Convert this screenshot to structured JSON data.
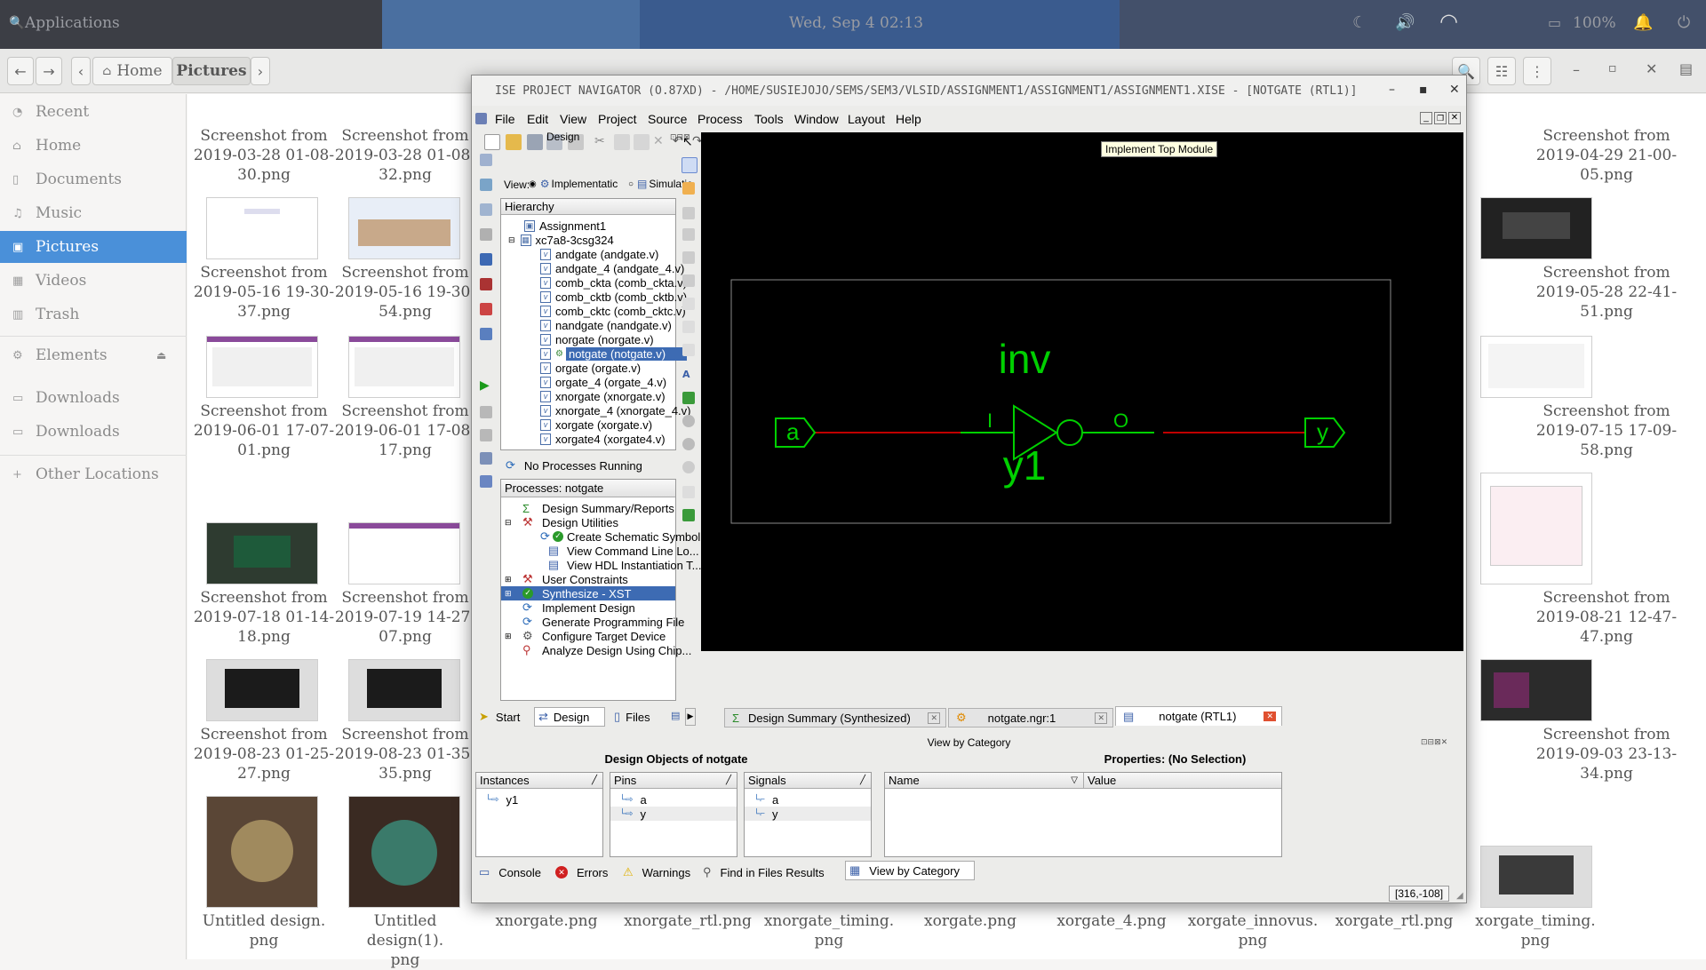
{
  "topbar": {
    "activities": "Applications",
    "clock": "Wed, Sep  4  02:13",
    "battery": "100%"
  },
  "files": {
    "breadcrumb": {
      "home": "Home",
      "current": "Pictures"
    },
    "sidebar": [
      {
        "label": "Recent",
        "icon": "clock-icon"
      },
      {
        "label": "Home",
        "icon": "home-icon"
      },
      {
        "label": "Documents",
        "icon": "document-icon"
      },
      {
        "label": "Music",
        "icon": "music-icon"
      },
      {
        "label": "Pictures",
        "icon": "picture-icon",
        "selected": true
      },
      {
        "label": "Videos",
        "icon": "video-icon"
      },
      {
        "label": "Trash",
        "icon": "trash-icon"
      },
      {
        "label": "Elements",
        "icon": "drive-icon"
      },
      {
        "label": "Downloads",
        "icon": "drive-icon"
      },
      {
        "label": "Downloads",
        "icon": "drive-icon"
      },
      {
        "label": "Other Locations",
        "icon": "plus-icon"
      }
    ],
    "items": [
      {
        "name": "Screenshot from 2019-03-28 01-08-30.png",
        "l1": "Screenshot from",
        "l2": "2019-03-28 01-08-",
        "l3": "30.png"
      },
      {
        "name": "Screenshot from 2019-03-28 01-08-32.png",
        "l1": "Screenshot from",
        "l2": "2019-03-28 01-08-",
        "l3": "32.png"
      },
      {
        "name": "Screenshot from 2019-04-29 21-00-05.png",
        "l1": "Screenshot from",
        "l2": "2019-04-29 21-00-",
        "l3": "05.png"
      },
      {
        "name": "Screenshot from 2019-05-16 19-30-37.png",
        "l1": "Screenshot from",
        "l2": "2019-05-16 19-30-",
        "l3": "37.png"
      },
      {
        "name": "Screenshot from 2019-05-16 19-30-54.png",
        "l1": "Screenshot from",
        "l2": "2019-05-16 19-30-",
        "l3": "54.png"
      },
      {
        "name": "Screenshot from 2019-05-28 22-41-51.png",
        "l1": "Screenshot from",
        "l2": "2019-05-28 22-41-",
        "l3": "51.png"
      },
      {
        "name": "Screenshot from 2019-06-01 17-07-01.png",
        "l1": "Screenshot from",
        "l2": "2019-06-01 17-07-",
        "l3": "01.png"
      },
      {
        "name": "Screenshot from 2019-06-01 17-08-17.png",
        "l1": "Screenshot from",
        "l2": "2019-06-01 17-08-",
        "l3": "17.png"
      },
      {
        "name": "Screenshot from 2019-07-15 17-09-58.png",
        "l1": "Screenshot from",
        "l2": "2019-07-15 17-09-",
        "l3": "58.png"
      },
      {
        "name": "Screenshot from 2019-07-18 01-14-18.png",
        "l1": "Screenshot from",
        "l2": "2019-07-18 01-14-",
        "l3": "18.png"
      },
      {
        "name": "Screenshot from 2019-07-19 14-27-07.png",
        "l1": "Screenshot from",
        "l2": "2019-07-19 14-27-",
        "l3": "07.png"
      },
      {
        "name": "Screenshot from 2019-08-21 12-47-47.png",
        "l1": "Screenshot from",
        "l2": "2019-08-21 12-47-",
        "l3": "47.png"
      },
      {
        "name": "Screenshot from 2019-08-23 01-25-27.png",
        "l1": "Screenshot from",
        "l2": "2019-08-23 01-25-",
        "l3": "27.png"
      },
      {
        "name": "Screenshot from 2019-08-23 01-35-35.png",
        "l1": "Screenshot from",
        "l2": "2019-08-23 01-35-",
        "l3": "35.png"
      },
      {
        "name": "Screenshot from 2019-09-03 23-13-34.png",
        "l1": "Screenshot from",
        "l2": "2019-09-03 23-13-",
        "l3": "34.png"
      },
      {
        "name": "Untitled design.png",
        "l1": "Untitled design.",
        "l2": "png",
        "l3": ""
      },
      {
        "name": "Untitled design(1).png",
        "l1": "Untitled design(1).",
        "l2": "png",
        "l3": ""
      },
      {
        "name": "xnorgate.png",
        "l1": "xnorgate.png",
        "l2": "",
        "l3": ""
      },
      {
        "name": "xnorgate_rtl.png",
        "l1": "xnorgate_rtl.png",
        "l2": "",
        "l3": ""
      },
      {
        "name": "xnorgate_timing.png",
        "l1": "xnorgate_timing.",
        "l2": "png",
        "l3": ""
      },
      {
        "name": "xorgate.png",
        "l1": "xorgate.png",
        "l2": "",
        "l3": ""
      },
      {
        "name": "xorgate_4.png",
        "l1": "xorgate_4.png",
        "l2": "",
        "l3": ""
      },
      {
        "name": "xorgate_innovus.png",
        "l1": "xorgate_innovus.",
        "l2": "png",
        "l3": ""
      },
      {
        "name": "xorgate_rtl.png",
        "l1": "xorgate_rtl.png",
        "l2": "",
        "l3": ""
      },
      {
        "name": "xorgate_timing.png",
        "l1": "xorgate_timing.",
        "l2": "png",
        "l3": ""
      }
    ]
  },
  "ise": {
    "title": "ISE PROJECT NAVIGATOR (O.87XD) - /HOME/SUSIEJOJO/SEMS/SEM3/VLSID/ASSIGNMENT1/ASSIGNMENT1/ASSIGNMENT1.XISE - [NOTGATE (RTL1)]",
    "menus": [
      "File",
      "Edit",
      "View",
      "Project",
      "Source",
      "Process",
      "Tools",
      "Window",
      "Layout",
      "Help"
    ],
    "tooltip": "Implement Top Module",
    "design_panel": {
      "title": "Design",
      "view_label": "View:",
      "view_impl": "Implementatic",
      "view_sim": "Simulatic",
      "hierarchy_header": "Hierarchy",
      "tree": [
        {
          "label": "Assignment1",
          "indent": 0,
          "icon": "project-icon"
        },
        {
          "label": "xc7a8-3csg324",
          "indent": 0,
          "icon": "chip-icon"
        },
        {
          "label": "andgate (andgate.v)",
          "indent": 1,
          "icon": "verilog-icon"
        },
        {
          "label": "andgate_4 (andgate_4.v)",
          "indent": 1,
          "icon": "verilog-icon"
        },
        {
          "label": "comb_ckta (comb_ckta.v)",
          "indent": 1,
          "icon": "verilog-icon"
        },
        {
          "label": "comb_cktb (comb_cktb.v)",
          "indent": 1,
          "icon": "verilog-icon"
        },
        {
          "label": "comb_cktc (comb_cktc.v)",
          "indent": 1,
          "icon": "verilog-icon"
        },
        {
          "label": "nandgate (nandgate.v)",
          "indent": 1,
          "icon": "verilog-icon"
        },
        {
          "label": "norgate (norgate.v)",
          "indent": 1,
          "icon": "verilog-icon"
        },
        {
          "label": "notgate (notgate.v)",
          "indent": 1,
          "icon": "verilog-icon",
          "selected": true
        },
        {
          "label": "orgate (orgate.v)",
          "indent": 1,
          "icon": "verilog-icon"
        },
        {
          "label": "orgate_4 (orgate_4.v)",
          "indent": 1,
          "icon": "verilog-icon"
        },
        {
          "label": "xnorgate (xnorgate.v)",
          "indent": 1,
          "icon": "verilog-icon"
        },
        {
          "label": "xnorgate_4 (xnorgate_4.v)",
          "indent": 1,
          "icon": "verilog-icon"
        },
        {
          "label": "xorgate (xorgate.v)",
          "indent": 1,
          "icon": "verilog-icon"
        },
        {
          "label": "xorgate4 (xorgate4.v)",
          "indent": 1,
          "icon": "verilog-icon"
        }
      ],
      "no_processes": "No Processes Running",
      "processes_header": "Processes: notgate",
      "processes": [
        {
          "label": "Design Summary/Reports",
          "indent": 1
        },
        {
          "label": "Design Utilities",
          "indent": 1
        },
        {
          "label": "Create Schematic Symbol",
          "indent": 2
        },
        {
          "label": "View Command Line Lo...",
          "indent": 2
        },
        {
          "label": "View HDL Instantiation T...",
          "indent": 2
        },
        {
          "label": "User Constraints",
          "indent": 1
        },
        {
          "label": "Synthesize - XST",
          "indent": 1,
          "selected": true
        },
        {
          "label": "Implement Design",
          "indent": 1
        },
        {
          "label": "Generate Programming File",
          "indent": 1
        },
        {
          "label": "Configure Target Device",
          "indent": 1
        },
        {
          "label": "Analyze Design Using Chip...",
          "indent": 1
        }
      ],
      "tabs": [
        "Start",
        "Design",
        "Files"
      ]
    },
    "schematic": {
      "instance_type": "inv",
      "instance_name": "y1",
      "input_port": "a",
      "output_port": "y",
      "pin_in": "I",
      "pin_out": "O"
    },
    "doc_tabs": [
      "Design Summary (Synthesized)",
      "notgate.ngr:1",
      "notgate (RTL1)"
    ],
    "bottom": {
      "view_by_category": "View by Category",
      "design_objects_title": "Design Objects of notgate",
      "properties_title": "Properties: (No Selection)",
      "instances": {
        "header": "Instances",
        "items": [
          "y1"
        ]
      },
      "pins": {
        "header": "Pins",
        "items": [
          "a",
          "y"
        ]
      },
      "signals": {
        "header": "Signals",
        "items": [
          "a",
          "y"
        ]
      },
      "prop_cols": [
        "Name",
        "Value"
      ],
      "console_tabs": [
        "Console",
        "Errors",
        "Warnings",
        "Find in Files Results",
        "View by Category"
      ],
      "coords": "[316,-108]"
    }
  },
  "colors": {
    "accent": "#4a90d9",
    "schematic_green": "#00d000",
    "wire_red": "#c00000"
  }
}
